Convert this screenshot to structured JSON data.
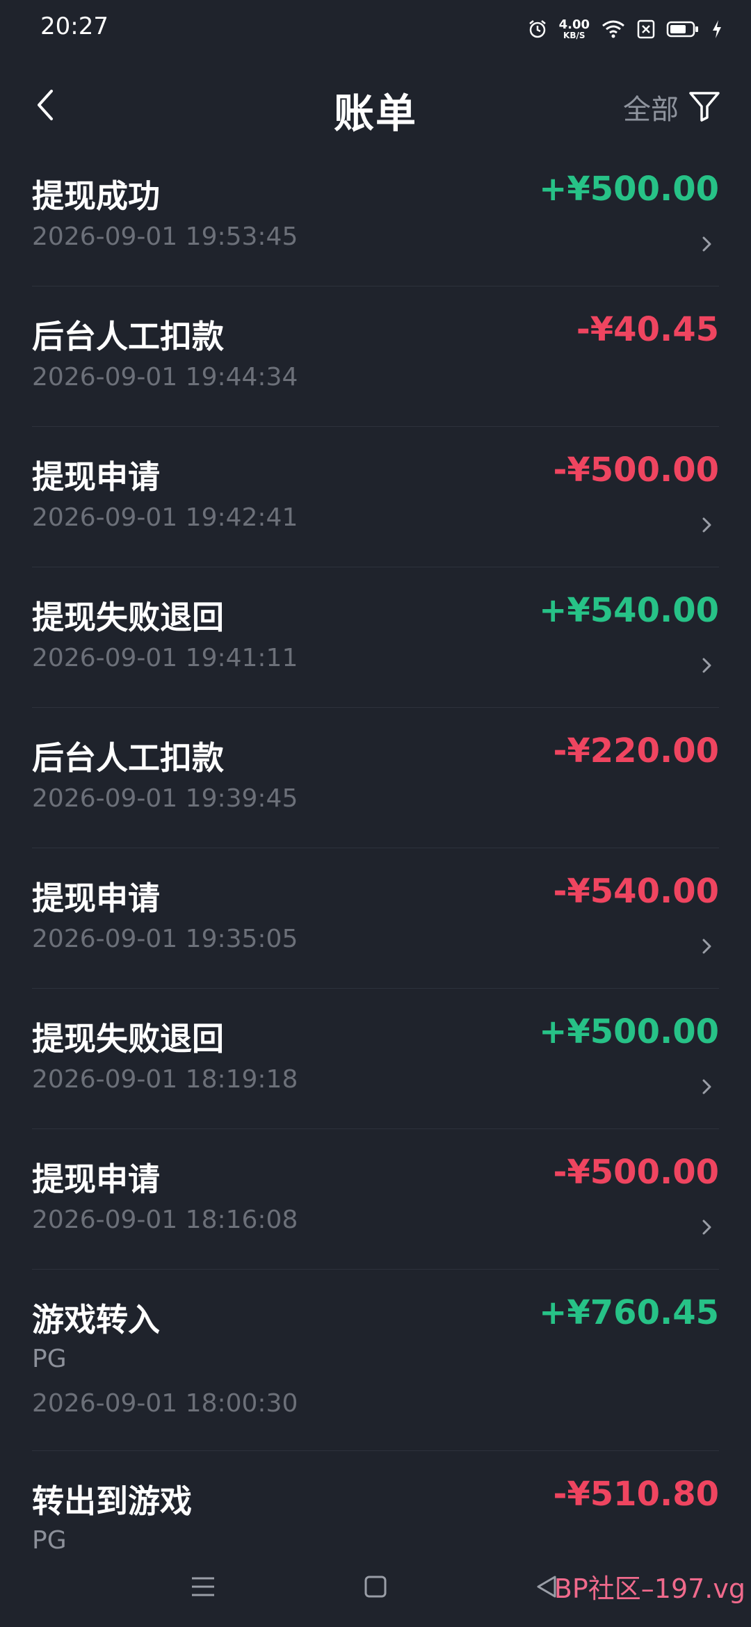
{
  "status_bar": {
    "time": "20:27",
    "net_speed_value": "4.00",
    "net_speed_unit": "KB/S",
    "icons": [
      "alarm-icon",
      "wifi-icon",
      "sim-disabled-icon",
      "battery-icon",
      "charging-icon"
    ]
  },
  "header": {
    "title": "账单",
    "filter_label": "全部",
    "back_icon": "chevron-left-icon",
    "filter_icon": "funnel-icon"
  },
  "transactions": [
    {
      "title": "提现成功",
      "amount": "+¥500.00",
      "positive": true,
      "sub": "",
      "time": "2026-09-01 19:53:45",
      "has_chevron": true
    },
    {
      "title": "后台人工扣款",
      "amount": "-¥40.45",
      "positive": false,
      "sub": "",
      "time": "2026-09-01 19:44:34",
      "has_chevron": false
    },
    {
      "title": "提现申请",
      "amount": "-¥500.00",
      "positive": false,
      "sub": "",
      "time": "2026-09-01 19:42:41",
      "has_chevron": true
    },
    {
      "title": "提现失败退回",
      "amount": "+¥540.00",
      "positive": true,
      "sub": "",
      "time": "2026-09-01 19:41:11",
      "has_chevron": true
    },
    {
      "title": "后台人工扣款",
      "amount": "-¥220.00",
      "positive": false,
      "sub": "",
      "time": "2026-09-01 19:39:45",
      "has_chevron": false
    },
    {
      "title": "提现申请",
      "amount": "-¥540.00",
      "positive": false,
      "sub": "",
      "time": "2026-09-01 19:35:05",
      "has_chevron": true
    },
    {
      "title": "提现失败退回",
      "amount": "+¥500.00",
      "positive": true,
      "sub": "",
      "time": "2026-09-01 18:19:18",
      "has_chevron": true
    },
    {
      "title": "提现申请",
      "amount": "-¥500.00",
      "positive": false,
      "sub": "",
      "time": "2026-09-01 18:16:08",
      "has_chevron": true
    },
    {
      "title": "游戏转入",
      "amount": "+¥760.45",
      "positive": true,
      "sub": "PG",
      "time": "2026-09-01 18:00:30",
      "has_chevron": false
    },
    {
      "title": "转出到游戏",
      "amount": "-¥510.80",
      "positive": false,
      "sub": "PG",
      "time": "",
      "has_chevron": false
    }
  ],
  "colors": {
    "background": "#1f232c",
    "positive": "#27c287",
    "negative": "#ef4560",
    "muted": "#8c909a"
  },
  "nav_bar": {
    "icons": [
      "menu-icon",
      "home-square-icon",
      "back-triangle-icon"
    ]
  },
  "watermark": "BP社区–197.vg"
}
